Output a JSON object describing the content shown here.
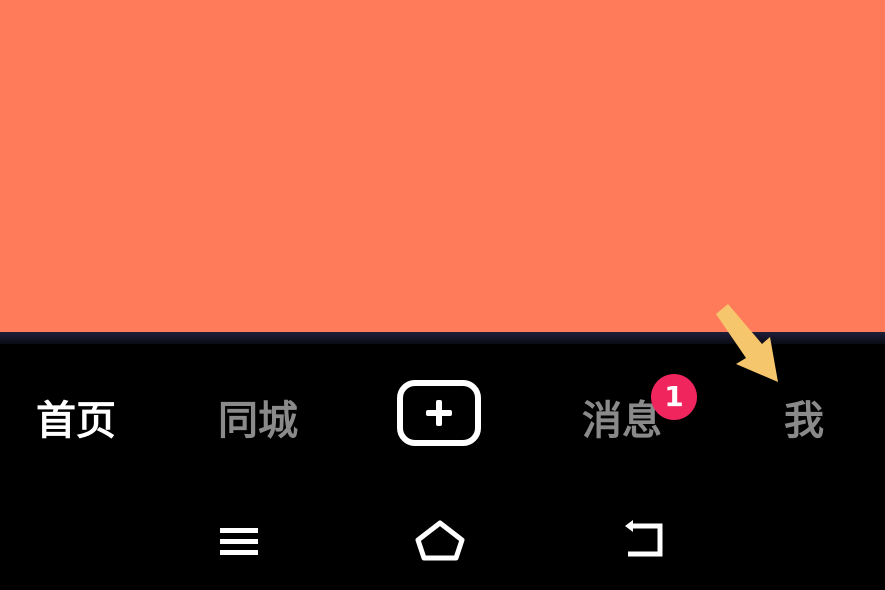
{
  "tabs": [
    {
      "label": "首页",
      "active": true
    },
    {
      "label": "同城",
      "active": false
    },
    {
      "label": "消息",
      "active": false,
      "badge": "1"
    },
    {
      "label": "我",
      "active": false
    }
  ],
  "create_button": {
    "icon": "plus-icon"
  },
  "annotation": {
    "icon": "pointer-arrow-icon",
    "color": "#f6c66c"
  },
  "system_nav": [
    {
      "icon": "menu-icon"
    },
    {
      "icon": "home-icon"
    },
    {
      "icon": "back-icon"
    }
  ],
  "colors": {
    "content_background": "#ff7b59",
    "tab_bar_background": "#000000",
    "active_tab": "#ffffff",
    "inactive_tab": "#8a8a8a",
    "badge": "#f0255e"
  }
}
